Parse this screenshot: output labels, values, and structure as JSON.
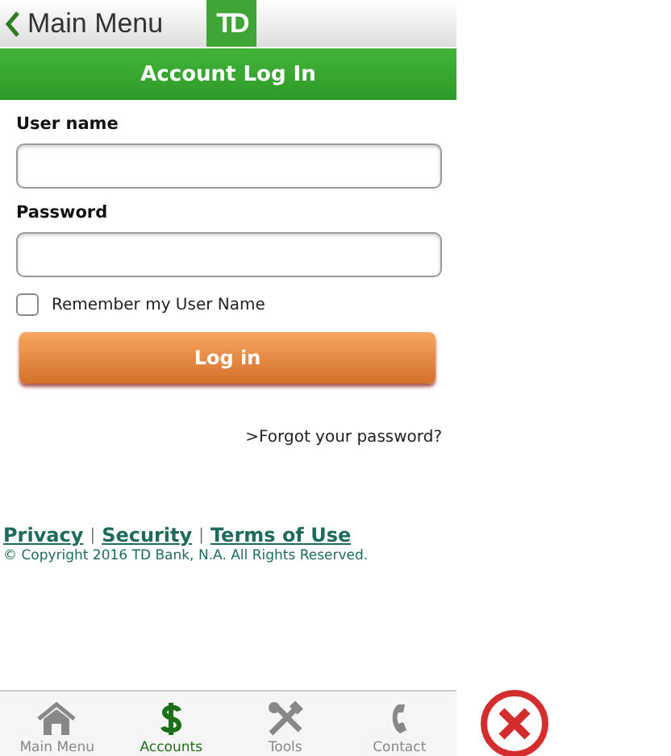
{
  "top_bar": {
    "back_label": "Main Menu",
    "logo": "TD"
  },
  "title_bar": {
    "title": "Account Log In"
  },
  "form": {
    "username_label": "User name",
    "password_label": "Password",
    "remember": {
      "label": "Remember my User Name",
      "checked": false
    },
    "submit": "Log in",
    "forgot": ">Forgot your password?"
  },
  "footer": {
    "items": [
      {
        "kind": "link",
        "text": "Privacy"
      },
      {
        "kind": "separator",
        "text": "|"
      },
      {
        "kind": "link",
        "text": "Security"
      },
      {
        "kind": "separator",
        "text": "|"
      },
      {
        "kind": "link",
        "text": "Terms of Use"
      }
    ],
    "copyright": "© Copyright 2016 TD Bank, N.A. All Rights Reserved."
  },
  "tab_bar": [
    {
      "label": "Main Menu",
      "kind": "home",
      "selected": false
    },
    {
      "label": "Accounts",
      "kind": "accounts",
      "selected": true
    },
    {
      "label": "Tools",
      "kind": "tools",
      "selected": false
    },
    {
      "label": "Contact",
      "kind": "contact",
      "selected": false
    }
  ]
}
